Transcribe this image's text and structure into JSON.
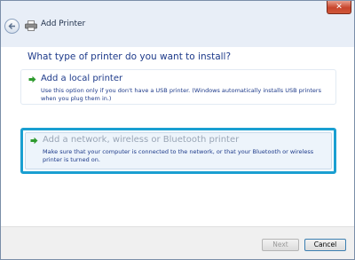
{
  "window": {
    "title": "Add Printer",
    "close_glyph": "✕"
  },
  "icons": {
    "back": "back-arrow-icon",
    "printer": "printer-icon",
    "option_arrow": "green-arrow-icon"
  },
  "main": {
    "question": "What type of printer do you want to install?"
  },
  "options": [
    {
      "title": "Add a local printer",
      "description_line1": "Use this option only if you don't have a USB printer. (Windows automatically installs USB printers",
      "description_line2": "when you plug them in.)"
    },
    {
      "title": "Add a network, wireless or Bluetooth printer",
      "description_line1": "Make sure that your computer is connected to the network, or that your Bluetooth or wireless",
      "description_line2": "printer is turned on."
    }
  ],
  "footer": {
    "next_label": "Next",
    "cancel_label": "Cancel"
  },
  "colors": {
    "accent_highlight": "#1a9fd1",
    "link_text": "#1d3a8a",
    "arrow_green": "#2f9b2f"
  }
}
